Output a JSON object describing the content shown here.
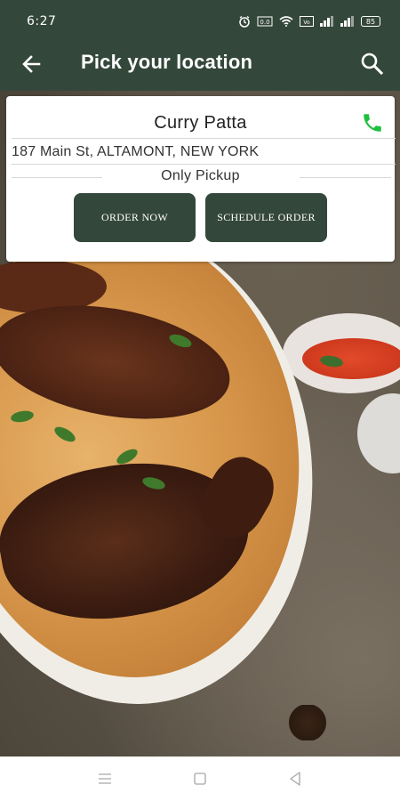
{
  "status_bar": {
    "time": "6:27",
    "battery": "85",
    "network_label": "VoLTE"
  },
  "app_bar": {
    "title": "Pick your location",
    "back_icon": "arrow-back-icon",
    "search_icon": "search-icon"
  },
  "restaurant": {
    "name": "Curry Patta",
    "address": "187 Main St, ALTAMONT, NEW YORK",
    "service_mode": "Only Pickup",
    "phone_icon": "phone-icon"
  },
  "actions": {
    "order_now_label": "ORDER NOW",
    "schedule_order_label": "SCHEDULE ORDER"
  },
  "nav_bar": {
    "menu_icon": "menu-icon",
    "home_icon": "home-icon",
    "back_icon": "nav-back-icon"
  },
  "colors": {
    "primary": "#34473b",
    "phone_green": "#1fbf3f",
    "card_bg": "#ffffff"
  }
}
